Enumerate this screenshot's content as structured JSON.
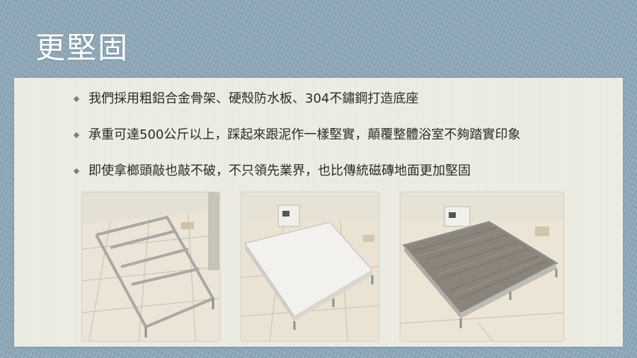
{
  "slide": {
    "title": "更堅固",
    "bullets": [
      "我們採用粗鋁合金骨架、硬殼防水板、304不鏽鋼打造底座",
      "承重可達500公斤以上，踩起來跟泥作一樣堅實，顛覆整體浴室不夠踏實印象",
      "即使拿榔頭敲也敲不破，不只領先業界，也比傳統磁磚地面更加堅固"
    ]
  },
  "photos": [
    {
      "name": "aluminum-frame-photo"
    },
    {
      "name": "waterproof-board-photo"
    },
    {
      "name": "finished-wood-floor-photo"
    }
  ],
  "colors": {
    "background": "#8fa9b9",
    "panel": "#eeede3",
    "title": "#ffffff",
    "text": "#2a2a2a"
  }
}
